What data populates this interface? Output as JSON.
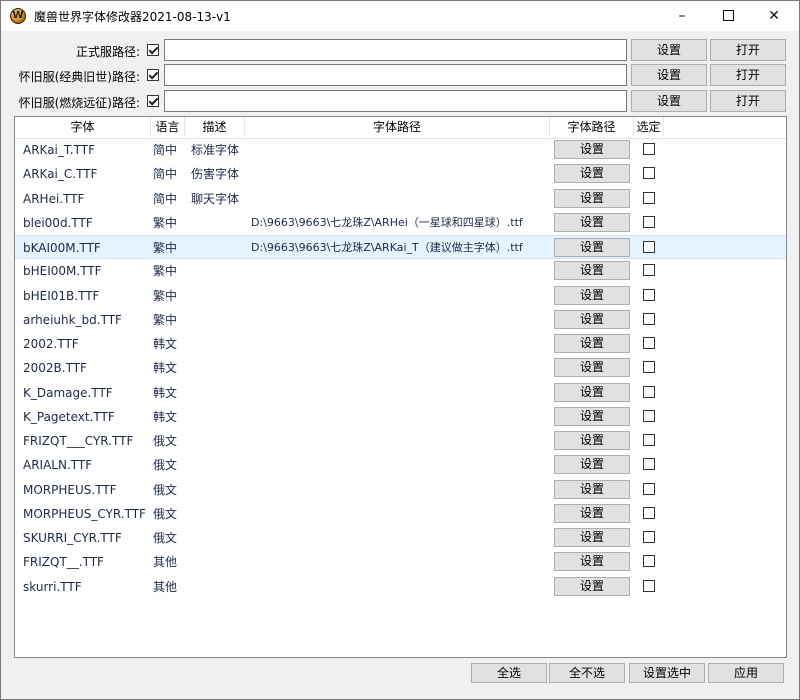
{
  "window": {
    "title": "魔兽世界字体修改器2021-08-13-v1",
    "icon": "W",
    "minimize": "–",
    "close": "✕"
  },
  "paths": [
    {
      "label": "正式服路径:",
      "checked": true,
      "value": "",
      "set_label": "设置",
      "open_label": "打开"
    },
    {
      "label": "怀旧服(经典旧世)路径:",
      "checked": true,
      "value": "",
      "set_label": "设置",
      "open_label": "打开"
    },
    {
      "label": "怀旧服(燃烧远征)路径:",
      "checked": true,
      "value": "",
      "set_label": "设置",
      "open_label": "打开"
    }
  ],
  "table": {
    "columns": [
      "字体",
      "语言",
      "描述",
      "字体路径",
      "字体路径",
      "选定"
    ],
    "rows": [
      {
        "font": "ARKai_T.TTF",
        "lang": "简中",
        "desc": "标准字体",
        "path": "",
        "btn": "设置",
        "selected": false
      },
      {
        "font": "ARKai_C.TTF",
        "lang": "简中",
        "desc": "伤害字体",
        "path": "",
        "btn": "设置",
        "selected": false
      },
      {
        "font": "ARHei.TTF",
        "lang": "简中",
        "desc": "聊天字体",
        "path": "",
        "btn": "设置",
        "selected": false
      },
      {
        "font": "blei00d.TTF",
        "lang": "繁中",
        "desc": "",
        "path": "D:\\9663\\9663\\七龙珠Z\\ARHei（一星球和四星球）.ttf",
        "btn": "设置",
        "selected": false
      },
      {
        "font": "bKAI00M.TTF",
        "lang": "繁中",
        "desc": "",
        "path": "D:\\9663\\9663\\七龙珠Z\\ARKai_T（建议做主字体）.ttf",
        "btn": "设置",
        "selected": false,
        "highlight": true
      },
      {
        "font": "bHEI00M.TTF",
        "lang": "繁中",
        "desc": "",
        "path": "",
        "btn": "设置",
        "selected": false
      },
      {
        "font": "bHEI01B.TTF",
        "lang": "繁中",
        "desc": "",
        "path": "",
        "btn": "设置",
        "selected": false
      },
      {
        "font": "arheiuhk_bd.TTF",
        "lang": "繁中",
        "desc": "",
        "path": "",
        "btn": "设置",
        "selected": false
      },
      {
        "font": "2002.TTF",
        "lang": "韩文",
        "desc": "",
        "path": "",
        "btn": "设置",
        "selected": false
      },
      {
        "font": "2002B.TTF",
        "lang": "韩文",
        "desc": "",
        "path": "",
        "btn": "设置",
        "selected": false
      },
      {
        "font": "K_Damage.TTF",
        "lang": "韩文",
        "desc": "",
        "path": "",
        "btn": "设置",
        "selected": false
      },
      {
        "font": "K_Pagetext.TTF",
        "lang": "韩文",
        "desc": "",
        "path": "",
        "btn": "设置",
        "selected": false
      },
      {
        "font": "FRIZQT___CYR.TTF",
        "lang": "俄文",
        "desc": "",
        "path": "",
        "btn": "设置",
        "selected": false
      },
      {
        "font": "ARIALN.TTF",
        "lang": "俄文",
        "desc": "",
        "path": "",
        "btn": "设置",
        "selected": false
      },
      {
        "font": "MORPHEUS.TTF",
        "lang": "俄文",
        "desc": "",
        "path": "",
        "btn": "设置",
        "selected": false
      },
      {
        "font": "MORPHEUS_CYR.TTF",
        "lang": "俄文",
        "desc": "",
        "path": "",
        "btn": "设置",
        "selected": false
      },
      {
        "font": "SKURRI_CYR.TTF",
        "lang": "俄文",
        "desc": "",
        "path": "",
        "btn": "设置",
        "selected": false
      },
      {
        "font": "FRIZQT__.TTF",
        "lang": "其他",
        "desc": "",
        "path": "",
        "btn": "设置",
        "selected": false
      },
      {
        "font": "skurri.TTF",
        "lang": "其他",
        "desc": "",
        "path": "",
        "btn": "设置",
        "selected": false
      }
    ]
  },
  "footer": {
    "select_all": "全选",
    "select_none": "全不选",
    "set_selected": "设置选中",
    "apply": "应用"
  }
}
